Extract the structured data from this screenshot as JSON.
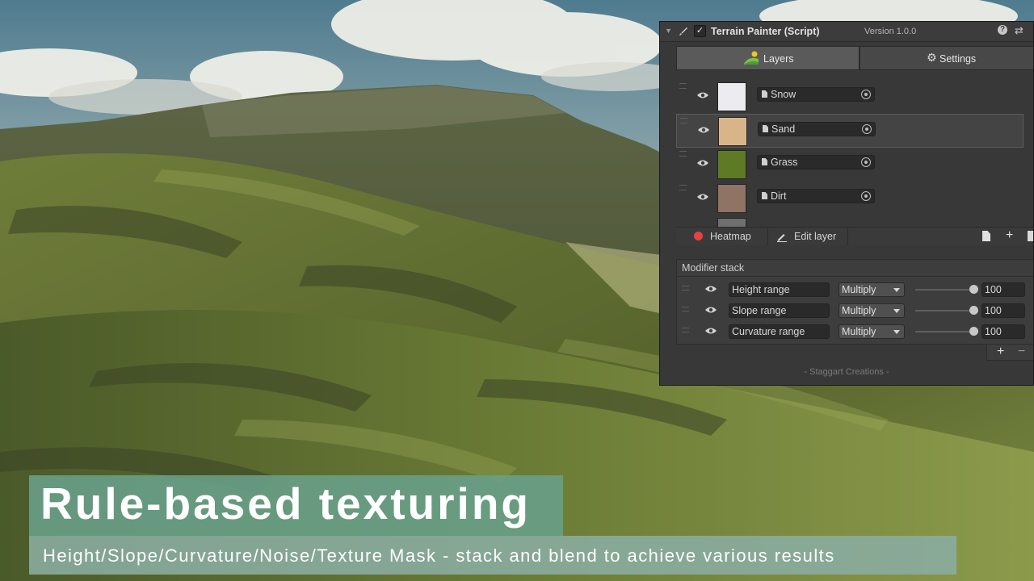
{
  "panel": {
    "title": "Terrain Painter (Script)",
    "version": "Version 1.0.0",
    "tabs": [
      {
        "label": "Layers",
        "active": true,
        "icon": "terrain-icon"
      },
      {
        "label": "Settings",
        "active": false,
        "icon": "gear-icon"
      }
    ],
    "layers": [
      {
        "name": "Snow",
        "color": "#ececf0",
        "selected": false
      },
      {
        "name": "Sand",
        "color": "#d8b588",
        "selected": true
      },
      {
        "name": "Grass",
        "color": "#5f7a24",
        "selected": false
      },
      {
        "name": "Dirt",
        "color": "#8f7466",
        "selected": false
      }
    ],
    "toolbar": {
      "heatmap": "Heatmap",
      "edit_layer": "Edit layer"
    },
    "modifier_stack": {
      "title": "Modifier stack",
      "modifiers": [
        {
          "name": "Height range",
          "blend": "Multiply",
          "value": "100"
        },
        {
          "name": "Slope range",
          "blend": "Multiply",
          "value": "100"
        },
        {
          "name": "Curvature range",
          "blend": "Multiply",
          "value": "100"
        }
      ]
    },
    "credit": "- Staggart Creations -"
  },
  "caption": {
    "title": "Rule-based texturing",
    "subtitle": "Height/Slope/Curvature/Noise/Texture Mask - stack and blend to achieve various results"
  },
  "colors": {
    "panel_bg": "#383838",
    "heatmap_dot": "#e74242",
    "caption_title_bg": "#689e88",
    "caption_sub_bg": "#8aac9e"
  }
}
